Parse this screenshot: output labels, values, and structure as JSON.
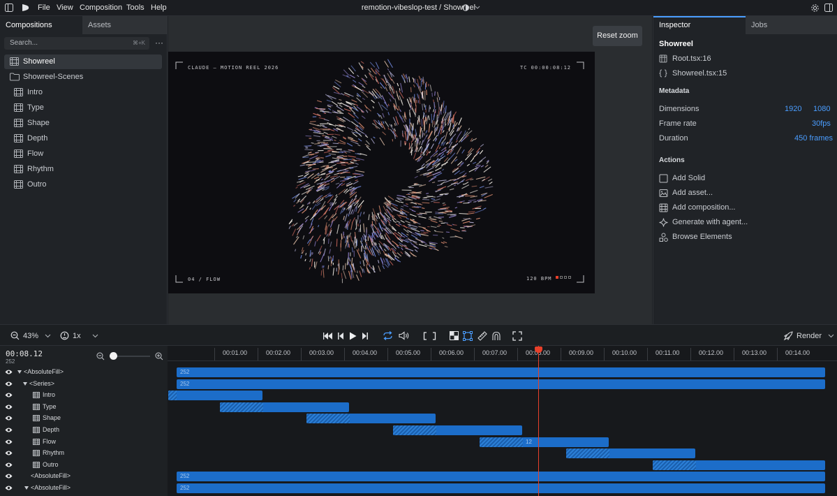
{
  "menu": {
    "items": [
      "File",
      "View",
      "Composition",
      "Tools",
      "Help"
    ],
    "title": "remotion-vibeslop-test / Showreel"
  },
  "left": {
    "tabs": [
      "Compositions",
      "Assets"
    ],
    "search_placeholder": "Search...",
    "search_shortcut": "⌘+K",
    "more": "···",
    "items": [
      {
        "label": "Showreel",
        "icon": "film-icon",
        "selected": true
      },
      {
        "label": "Showreel-Scenes",
        "icon": "folder-icon"
      },
      {
        "label": "Intro",
        "icon": "film-icon"
      },
      {
        "label": "Type",
        "icon": "film-icon"
      },
      {
        "label": "Shape",
        "icon": "film-icon"
      },
      {
        "label": "Depth",
        "icon": "film-icon"
      },
      {
        "label": "Flow",
        "icon": "film-icon"
      },
      {
        "label": "Rhythm",
        "icon": "film-icon"
      },
      {
        "label": "Outro",
        "icon": "film-icon"
      }
    ]
  },
  "center": {
    "reset_zoom": "Reset zoom",
    "preview": {
      "top_left": "CLAUDE — MOTION REEL 2026",
      "top_right": "TC 00:00:08:12",
      "bottom_left": "04 / FLOW",
      "bottom_right": "120 BPM"
    }
  },
  "right": {
    "tabs": [
      "Inspector",
      "Jobs"
    ],
    "comp_name": "Showreel",
    "files": [
      "Root.tsx:16",
      "Showreel.tsx:15"
    ],
    "metadata_heading": "Metadata",
    "metadata": {
      "dimensions_label": "Dimensions",
      "width": "1920",
      "height": "1080",
      "framerate_label": "Frame rate",
      "framerate": "30fps",
      "duration_label": "Duration",
      "duration": "450 frames"
    },
    "actions_heading": "Actions",
    "actions": [
      "Add Solid",
      "Add asset...",
      "Add composition...",
      "Generate with agent...",
      "Browse Elements"
    ]
  },
  "toolbar": {
    "zoom": "43%",
    "speed": "1x",
    "render": "Render"
  },
  "timeline": {
    "timecode": "00:08.12",
    "frame": "252",
    "ticks": [
      "00:01.00",
      "00:02.00",
      "00:03.00",
      "00:04.00",
      "00:05.00",
      "00:06.00",
      "00:07.00",
      "00:08.00",
      "00:09.00",
      "00:10.00",
      "00:11.00",
      "00:12.00",
      "00:13.00",
      "00:14.00"
    ],
    "tracks": [
      {
        "label": "<AbsoluteFill>",
        "badge": "252"
      },
      {
        "label": "<Series>",
        "badge": "252"
      },
      {
        "label": "Intro",
        "badge": ""
      },
      {
        "label": "Type",
        "badge": ""
      },
      {
        "label": "Shape",
        "badge": ""
      },
      {
        "label": "Depth",
        "badge": ""
      },
      {
        "label": "Flow",
        "badge": "12"
      },
      {
        "label": "Rhythm",
        "badge": ""
      },
      {
        "label": "Outro",
        "badge": ""
      },
      {
        "label": "<AbsoluteFill>",
        "badge": "252"
      },
      {
        "label": "<AbsoluteFill>",
        "badge": "252"
      }
    ]
  },
  "colors": {
    "accent": "#4a9dff",
    "sequence": "#1c6dc9",
    "playhead": "#e8402a"
  }
}
